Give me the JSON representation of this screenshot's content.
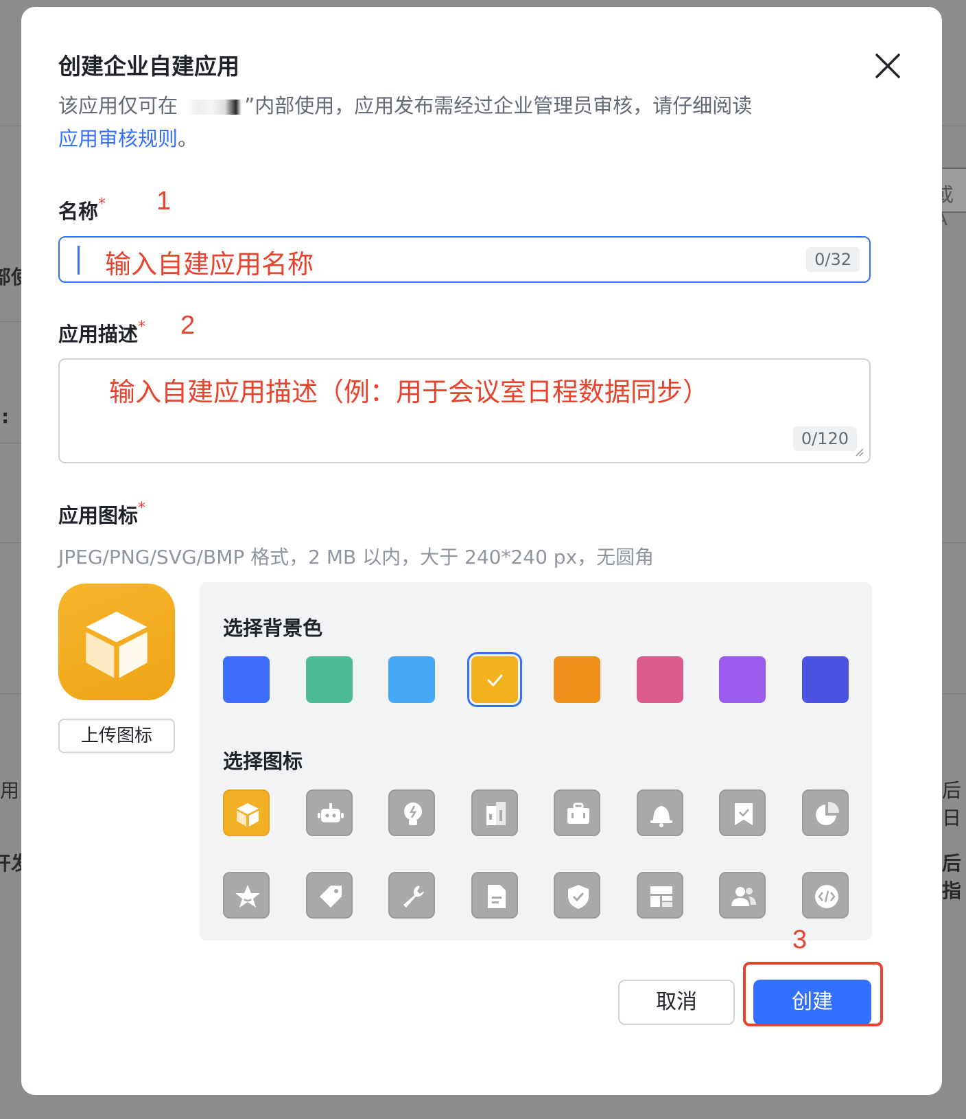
{
  "background": {
    "fragments": [
      "部使",
      ":",
      "用",
      "开发",
      "或 A",
      "后日",
      "后指"
    ]
  },
  "dialog": {
    "title": "创建企业自建应用",
    "desc_before": "该应用仅可在",
    "desc_after": "”内部使用，应用发布需经过企业管理员审核，请仔细阅读",
    "desc_link": "应用审核规则",
    "desc_end": "。"
  },
  "name_field": {
    "label": "名称",
    "required": "*",
    "placeholder": "输入自建应用名称",
    "counter": "0/32"
  },
  "desc_field": {
    "label": "应用描述",
    "required": "*",
    "placeholder": "输入自建应用描述（例：用于会议室日程数据同步）",
    "counter": "0/120"
  },
  "icon_section": {
    "label": "应用图标",
    "required": "*",
    "hint": "JPEG/PNG/SVG/BMP 格式，2 MB 以内，大于 240*240 px，无圆角",
    "upload_label": "上传图标",
    "bg_title": "选择背景色",
    "icon_title": "选择图标",
    "colors": [
      "#3d6dfc",
      "#4cbc98",
      "#45a9f8",
      "#f2b11f",
      "#ef8f1c",
      "#d95b8c",
      "#9b5ced",
      "#4a53e0"
    ],
    "selected_color_index": 3,
    "icons": [
      "cube-icon",
      "robot-icon",
      "bulb-icon",
      "building-icon",
      "briefcase-icon",
      "bell-icon",
      "bookmark-icon",
      "pie-chart-icon",
      "star-icon",
      "tag-icon",
      "wrench-icon",
      "document-icon",
      "shield-icon",
      "layout-icon",
      "users-icon",
      "code-icon"
    ],
    "selected_icon_index": 0
  },
  "footer": {
    "cancel_label": "取消",
    "create_label": "创建"
  },
  "annotations": [
    "1",
    "2",
    "3"
  ]
}
